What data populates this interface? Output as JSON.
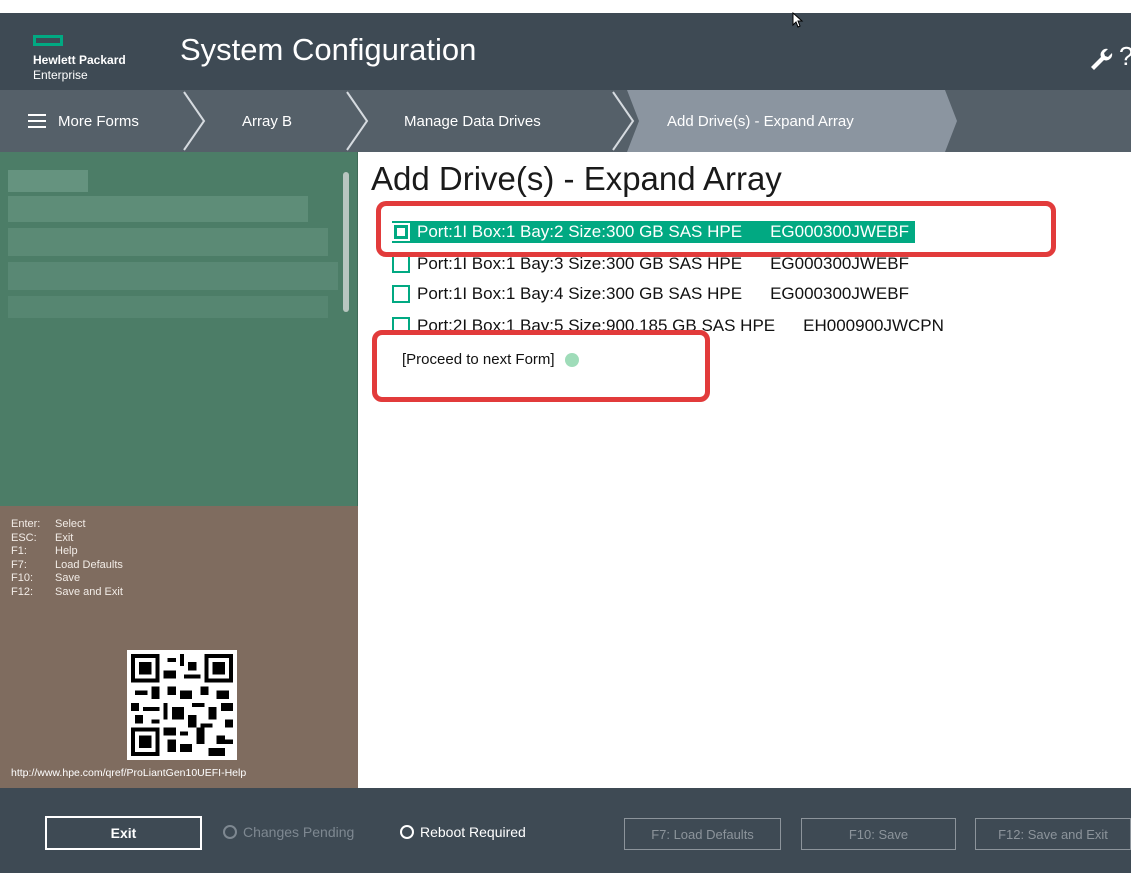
{
  "window": {
    "vendor_line1": "Hewlett Packard",
    "vendor_line2": "Enterprise",
    "title": "System Configuration",
    "help_glyph": "?"
  },
  "breadcrumb": [
    {
      "label": "More Forms",
      "icon": "menu-icon"
    },
    {
      "label": "Array B"
    },
    {
      "label": "Manage Data Drives"
    },
    {
      "label": "Add Drive(s) - Expand Array",
      "active": true
    }
  ],
  "main": {
    "title": "Add Drive(s) - Expand Array",
    "drives": [
      {
        "desc": "Port:1I Box:1 Bay:2 Size:300 GB SAS HPE",
        "model": "EG000300JWEBF",
        "selected": true
      },
      {
        "desc": "Port:1I Box:1 Bay:3 Size:300 GB SAS HPE",
        "model": "EG000300JWEBF",
        "selected": false
      },
      {
        "desc": "Port:1I Box:1 Bay:4 Size:300 GB SAS HPE",
        "model": "EG000300JWEBF",
        "selected": false
      },
      {
        "desc": "Port:2I Box:1 Bay:5 Size:900.185 GB SAS HPE",
        "model": "EH000900JWCPN",
        "selected": false
      }
    ],
    "proceed_label": "[Proceed to next Form]"
  },
  "keys": [
    {
      "key": "Enter:",
      "action": "Select"
    },
    {
      "key": "ESC:",
      "action": "Exit"
    },
    {
      "key": "F1:",
      "action": "Help"
    },
    {
      "key": "F7:",
      "action": "Load Defaults"
    },
    {
      "key": "F10:",
      "action": "Save"
    },
    {
      "key": "F12:",
      "action": "Save and Exit"
    }
  ],
  "help_url": "http://www.hpe.com/qref/ProLiantGen10UEFI-Help",
  "footer": {
    "exit_label": "Exit",
    "status": [
      {
        "label": "Changes Pending",
        "enabled": false
      },
      {
        "label": "Reboot Required",
        "enabled": true
      }
    ],
    "buttons": [
      {
        "label": "F7: Load Defaults"
      },
      {
        "label": "F10: Save"
      },
      {
        "label": "F12: Save and Exit"
      }
    ]
  },
  "colors": {
    "accent": "#01a982",
    "header_bg": "#3e4a54",
    "left_top_bg": "#4c7d67",
    "left_bottom_bg": "#7f6c5f",
    "annotation_red": "#e23b3b"
  }
}
